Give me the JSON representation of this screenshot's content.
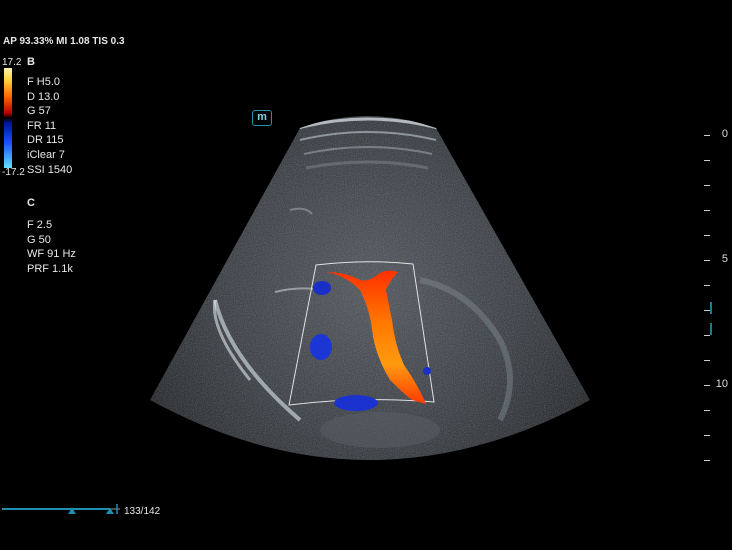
{
  "header": {
    "power_info": "AP 93.33%  MI 1.08 TIS 0.3"
  },
  "color_bar": {
    "max_label": "17.2",
    "min_label": "-17.2"
  },
  "mode_b": {
    "title": "B",
    "params": [
      "F H5.0",
      "D 13.0",
      "G 57",
      "FR 11",
      "DR 115",
      "iClear 7",
      "SSI 1540"
    ]
  },
  "mode_c": {
    "title": "C",
    "params": [
      "F 2.5",
      "G 50",
      "WF 91 Hz",
      "PRF 1.1k"
    ]
  },
  "probe_marker": "m",
  "depth_scale": {
    "labels": [
      "0",
      "5",
      "10"
    ]
  },
  "cine": {
    "frame_counter": "133/142",
    "position_fraction": 0.937
  },
  "colors": {
    "accent": "#1f8fb0",
    "flow_red": "#ff3a00",
    "flow_blue": "#1a2fc8"
  }
}
